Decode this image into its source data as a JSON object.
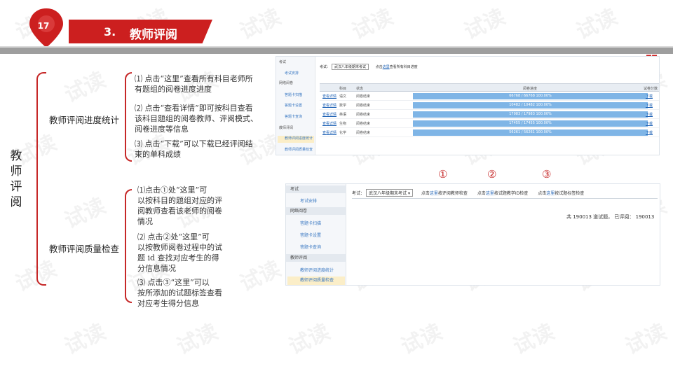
{
  "header": {
    "page_number": "17",
    "section_number": "3.",
    "section_title": "教师评阅",
    "quote_mark": "❞",
    "accent_color": "#cc1f1f"
  },
  "watermark": "试读",
  "mindmap": {
    "root": "教师评阅",
    "branches": [
      {
        "label": "教师评阅进度统计",
        "items": [
          [
            "⑴  点击“这里”查看所有科目老师所",
            "有题组的阅卷进度进度"
          ],
          [
            "⑵  点击“查看详情”即可按科目查看",
            "该科目题组的阅卷教师、评阅模式、",
            "阅卷进度等信息"
          ],
          [
            "⑶  点击“下载”可以下载已经评阅结",
            "束的单科成绩"
          ]
        ]
      },
      {
        "label": "教师评阅质量检查",
        "items": [
          [
            "⑴点击①处“这里”可",
            "以按科目的题组对应的评",
            "阅教师查看该老师的阅卷",
            "情况"
          ],
          [
            "⑵  点击②处“这里”可",
            "以按教师阅卷过程中的试",
            "题 id 查找对应考生的得",
            "分信息情况"
          ],
          [
            "⑶  点击③“这里”可以",
            "按所添加的试题标签查看",
            "对应考生得分信息"
          ]
        ]
      }
    ]
  },
  "shot1": {
    "sidebar": [
      "考试",
      "考试安排",
      "网络阅卷",
      "答题卡扫描",
      "答题卡设置",
      "答题卡查询",
      "教师评阅",
      "教师评阅进度统计",
      "教师评阅质量检查"
    ],
    "exam_label": "考试：",
    "exam_select": "武汉八年级期末考试",
    "hint_pre": "点击",
    "hint_link": "这里",
    "hint_post": "查看所有科目进度",
    "columns": [
      "科目",
      "状态",
      "阅卷进度",
      "试卷分数"
    ],
    "rows": [
      {
        "link": "查看详情",
        "subject": "语文",
        "status": "阅卷结束",
        "progress": "66768 / 66768  100.00%",
        "download": "下载"
      },
      {
        "link": "查看详情",
        "subject": "数学",
        "status": "阅卷结束",
        "progress": "10482 / 10482  100.00%",
        "download": "下载"
      },
      {
        "link": "查看详情",
        "subject": "英语",
        "status": "阅卷结束",
        "progress": "17983 / 17983  100.00%",
        "download": "下载"
      },
      {
        "link": "查看详情",
        "subject": "生物",
        "status": "阅卷结束",
        "progress": "17455 / 17455  100.00%",
        "download": "下载"
      },
      {
        "link": "查看详情",
        "subject": "化学",
        "status": "阅卷结束",
        "progress": "56261 / 56261  100.00%",
        "download": "下载"
      }
    ]
  },
  "markers": [
    "①",
    "②",
    "③"
  ],
  "shot2": {
    "sidebar_groups": [
      "考试",
      "网络阅卷",
      "教师评阅"
    ],
    "sidebar_subs": [
      "考试安排",
      "答题卡扫描",
      "答题卡设置",
      "答题卡查询",
      "教师评阅进度统计",
      "教师评阅质量检查"
    ],
    "exam_label": "考试：",
    "exam_select": "武汉八年级期末考试",
    "link_parts": [
      {
        "pre": "点击",
        "link": "这里",
        "post": "按评阅教师检查"
      },
      {
        "pre": "点击",
        "link": "这里",
        "post": "按试题教学ID检查"
      },
      {
        "pre": "点击",
        "link": "这里",
        "post": "按试题标签检查"
      }
    ],
    "summary": "共 190013 道试题， 已评阅： 190013"
  }
}
